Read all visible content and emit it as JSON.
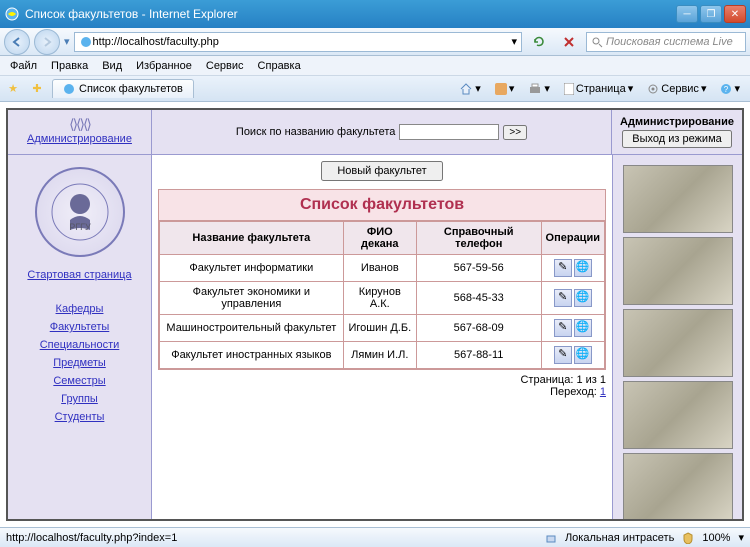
{
  "window": {
    "title": "Список факультетов - Internet Explorer"
  },
  "nav": {
    "url": "http://localhost/faculty.php",
    "search_placeholder": "Поисковая система Live"
  },
  "menu": [
    "Файл",
    "Правка",
    "Вид",
    "Избранное",
    "Сервис",
    "Справка"
  ],
  "tab": {
    "title": "Список факультетов"
  },
  "tools": {
    "page": "Страница",
    "service": "Сервис"
  },
  "topstrip": {
    "admin": "Администрирование",
    "search_label": "Поиск по названию факультета",
    "go": ">>",
    "admin2": "Администрирование",
    "exit": "Выход из режима"
  },
  "leftnav": {
    "logo_text": "РГГУ",
    "start": "Стартовая страница",
    "items": [
      "Кафедры",
      "Факультеты",
      "Специальности",
      "Предметы",
      "Семестры",
      "Группы",
      "Студенты"
    ]
  },
  "main": {
    "new_btn": "Новый факультет",
    "title": "Список факультетов",
    "headers": [
      "Название факультета",
      "ФИО декана",
      "Справочный телефон",
      "Операции"
    ],
    "rows": [
      {
        "name": "Факультет информатики",
        "dean": "Иванов",
        "phone": "567-59-56"
      },
      {
        "name": "Факультет экономики и управления",
        "dean": "Кирунов А.К.",
        "phone": "568-45-33"
      },
      {
        "name": "Машиностроительный факультет",
        "dean": "Игошин Д.Б.",
        "phone": "567-68-09"
      },
      {
        "name": "Факультет иностранных языков",
        "dean": "Лямин И.Л.",
        "phone": "567-88-11"
      }
    ],
    "pager_text": "Страница: 1 из 1",
    "pager_goto": "Переход:",
    "pager_link": "1"
  },
  "status": {
    "url": "http://localhost/faculty.php?index=1",
    "zone": "Локальная интрасеть",
    "zoom": "100%"
  }
}
